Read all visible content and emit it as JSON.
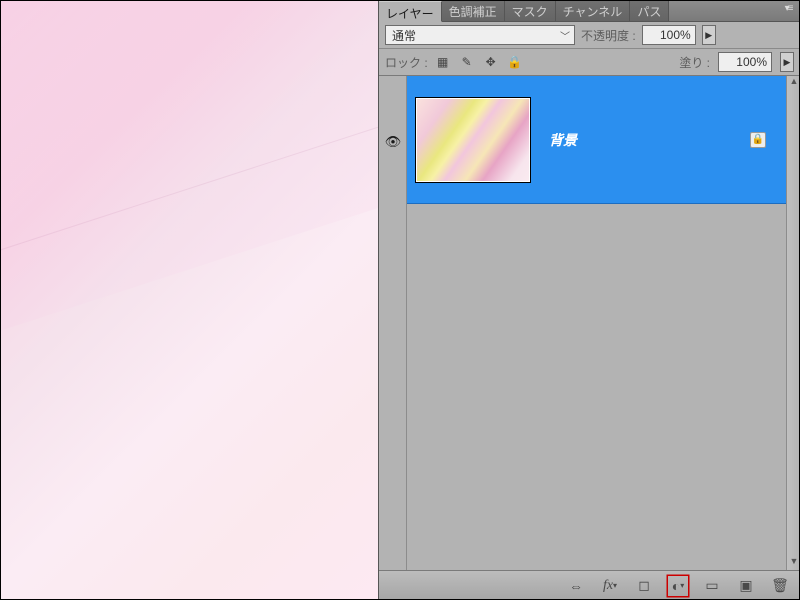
{
  "tabs": {
    "layers": "レイヤー",
    "adjustments": "色調補正",
    "masks": "マスク",
    "channels": "チャンネル",
    "paths": "パス"
  },
  "blend": {
    "mode": "通常",
    "opacity_label": "不透明度 :",
    "opacity_value": "100%",
    "fill_label": "塗り :",
    "fill_value": "100%",
    "lock_label": "ロック :"
  },
  "layers": [
    {
      "name": "背景",
      "visible": true,
      "locked": true
    }
  ],
  "icons": {
    "link": "⇔",
    "fx": "fx",
    "mask": "◐",
    "adjust": "◑",
    "group": "▭",
    "new": "⧉",
    "trash": "🗑"
  }
}
